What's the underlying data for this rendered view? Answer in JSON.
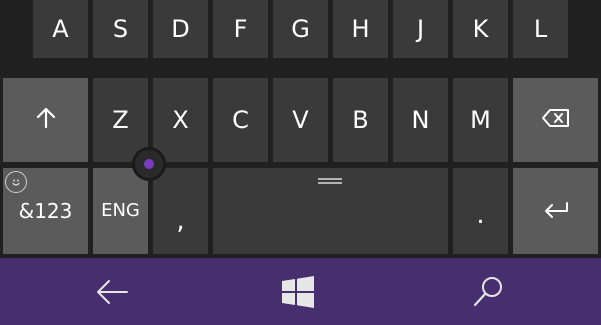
{
  "keyboard": {
    "row_home": [
      "A",
      "S",
      "D",
      "F",
      "G",
      "H",
      "J",
      "K",
      "L"
    ],
    "row_bottom": [
      "Z",
      "X",
      "C",
      "V",
      "B",
      "N",
      "M"
    ],
    "num_label": "&123",
    "lang_label": "ENG",
    "comma_label": ",",
    "period_label": ".",
    "shift_icon": "up-arrow-icon",
    "backspace_icon": "backspace-icon",
    "enter_icon": "enter-icon",
    "emoji_icon": "smiley-icon",
    "accent_color": "#472f6f",
    "cursor_color": "#7a3bbf"
  },
  "navbar": {
    "back_icon": "back-arrow-icon",
    "start_icon": "windows-logo-icon",
    "search_icon": "search-icon"
  }
}
